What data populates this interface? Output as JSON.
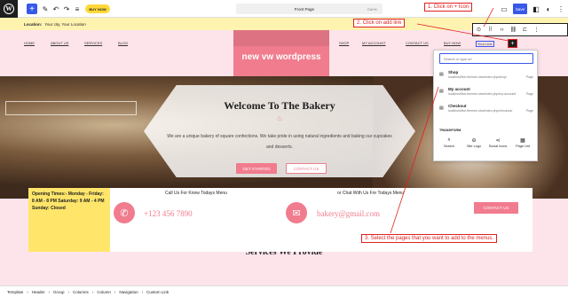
{
  "editor": {
    "doc_title": "Front Page",
    "shortcut": "Ctrl+K",
    "buy_now": "BUY NOW",
    "save_label": "Save"
  },
  "site": {
    "location_label": "Location:",
    "location_value": "Your city, Your Location",
    "nav_left": [
      "HOME",
      "ABOUT US",
      "SERVICES",
      "BLOG"
    ],
    "nav_right": [
      "SHOP",
      "MY ACCOUNT",
      "CONTACT US",
      "BUY NOW",
      "Your Link"
    ],
    "logo": "new vw wordpress",
    "hero_title": "Welcome To The Bakery",
    "hero_desc": "We are a unique bakery of square confections. We take pride in using natural ingredients and baking our cupcakes and desserts.",
    "hero_btn_primary": "GET STARTED",
    "hero_btn_secondary": "CONTACT US",
    "hours": "Opening Times:- Monday - Friday: 8 AM - 8 PM Saturday: 9 AM - 4 PM Sunday: Closed",
    "call_label": "Call Us For Know Todays Menu",
    "phone": "+123 456 7890",
    "chat_label": "or Chat With Us For Todays Menu",
    "email": "bakery@gmail.com",
    "contact_btn": "CONTACT US",
    "services_heading": "Services We Provide"
  },
  "link_popover": {
    "search_placeholder": "Search or type url",
    "suggestions": [
      {
        "name": "Shop",
        "url": "localhost/live-themes-new/index.php/shop/",
        "type": "Page"
      },
      {
        "name": "My account",
        "url": "localhost/live-themes-new/index.php/my-account/",
        "type": "Page"
      },
      {
        "name": "Checkout",
        "url": "localhost/live-themes-new/index.php/checkout/",
        "type": "Page"
      }
    ],
    "transform_label": "TRANSFORM",
    "transforms": [
      "Search",
      "Site Logo",
      "Social Icons",
      "Page List"
    ]
  },
  "annotations": {
    "step1": "1. Click on + Icon",
    "step2": "2. Click on add link",
    "step3": "3. Select the pages that you want to add to the menus."
  },
  "breadcrumb": [
    "Template",
    "Header",
    "Group",
    "Columns",
    "Column",
    "Navigation",
    "Custom Link"
  ],
  "colors": {
    "accent": "#3858e9",
    "brand_pink": "#f07c8e",
    "annotation_red": "#e02020",
    "hours_yellow": "#ffe66b"
  }
}
